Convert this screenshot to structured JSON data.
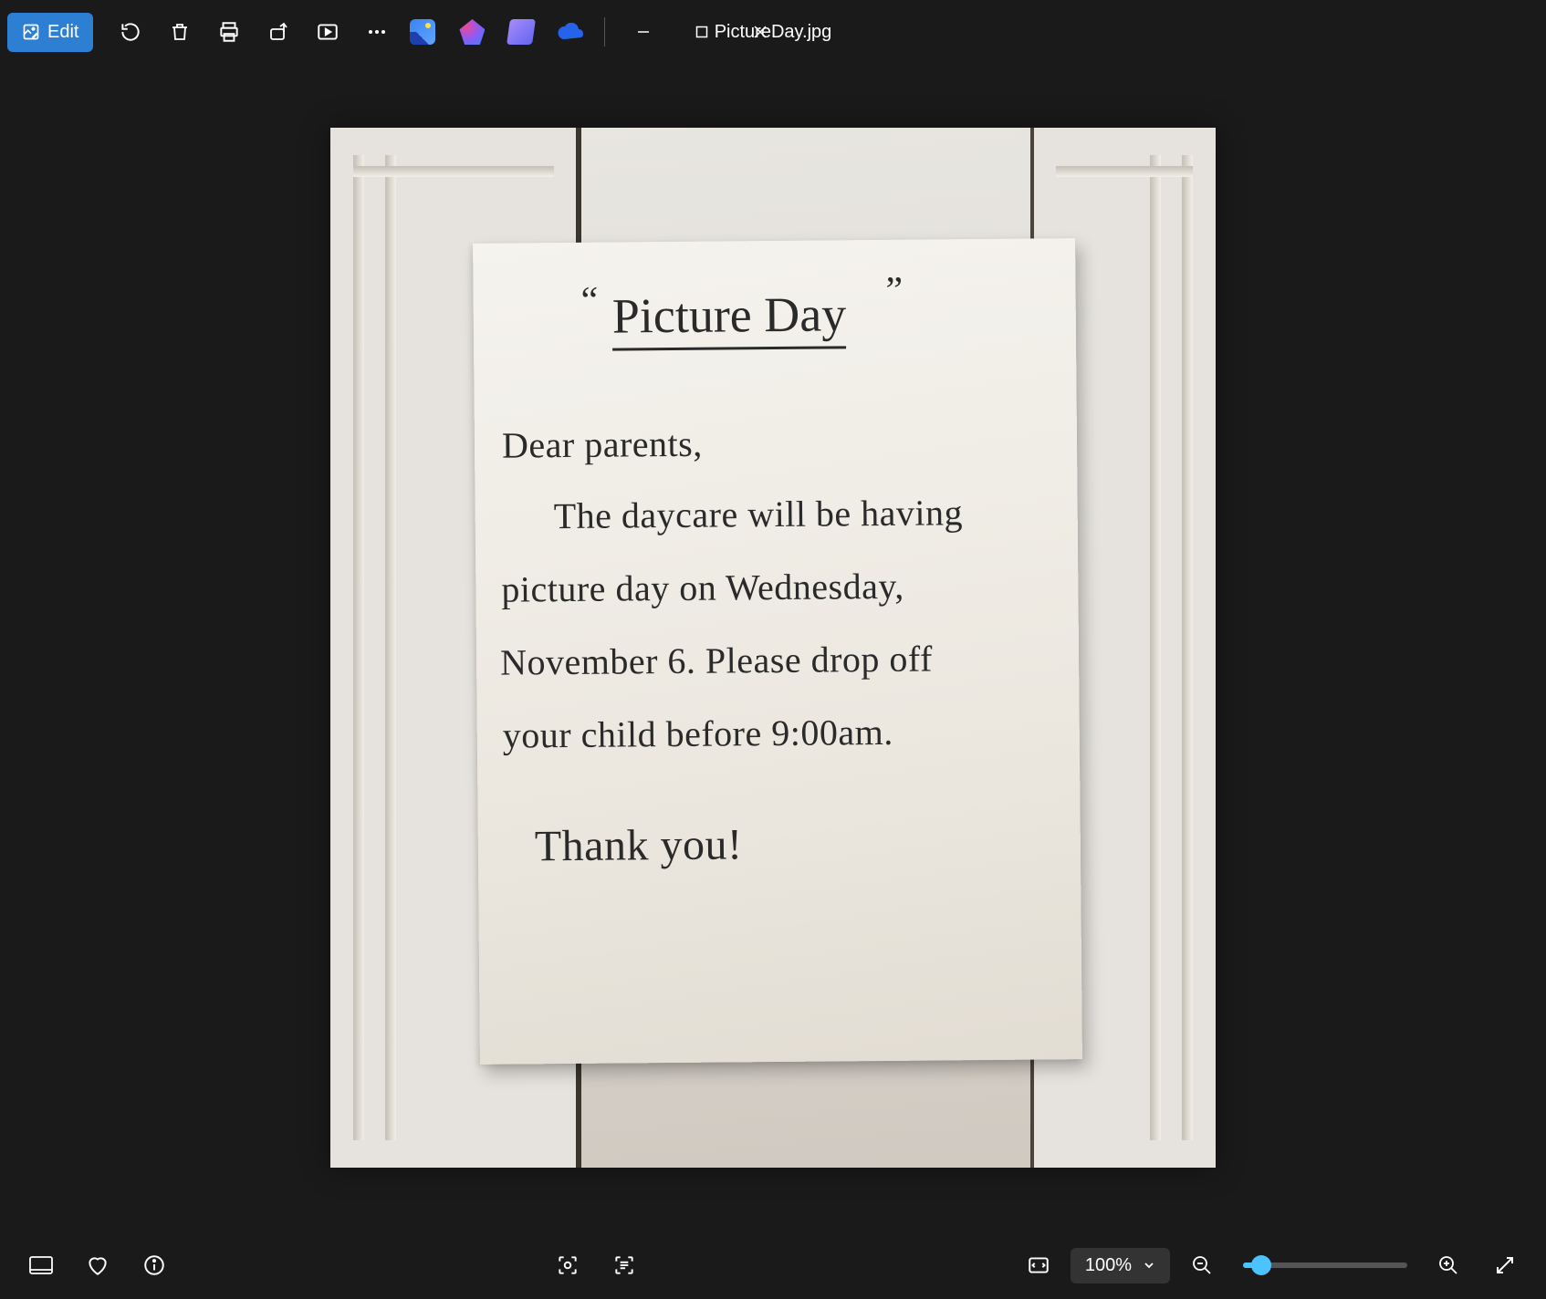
{
  "titlebar": {
    "edit_label": "Edit",
    "filename": "PictureDay.jpg"
  },
  "note": {
    "quote_left": "“",
    "title": "Picture Day",
    "quote_right": "”",
    "line1": "Dear parents,",
    "line2": "The daycare will be having",
    "line3": "picture day on Wednesday,",
    "line4": "November 6. Please drop off",
    "line5": "your child before 9:00am.",
    "line6": "Thank you!"
  },
  "statusbar": {
    "zoom_label": "100%"
  }
}
